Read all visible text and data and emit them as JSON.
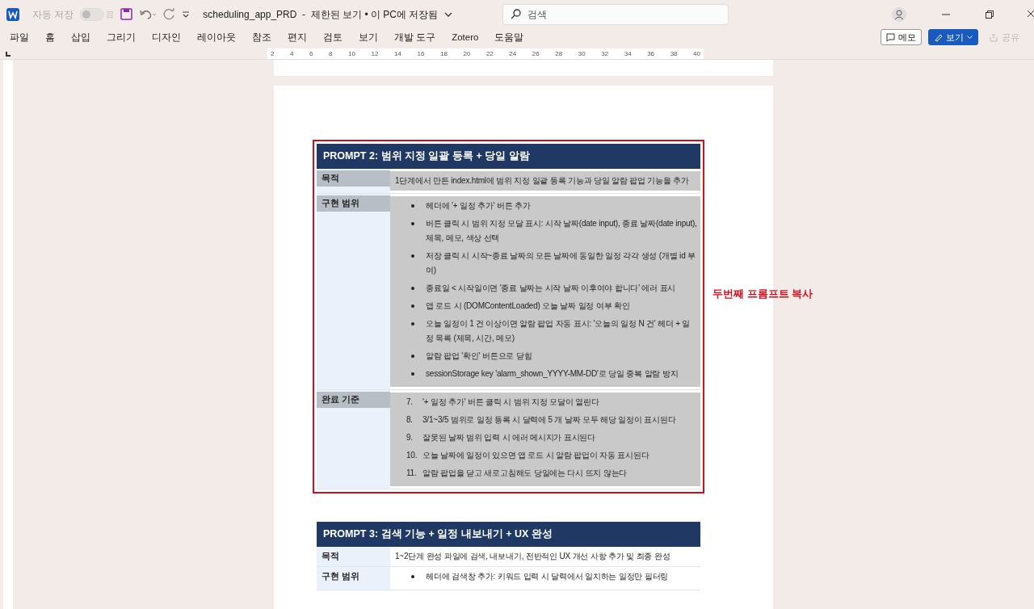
{
  "titlebar": {
    "autosave_label": "자동 저장",
    "autosave_state": "끔",
    "autosave_on": false,
    "document_title": "scheduling_app_PRD  -  제한된 보기 • 이 PC에 저장됨",
    "search": {
      "placeholder": "검색"
    }
  },
  "ribbon_tabs": [
    {
      "label": "파일",
      "selected": false
    },
    {
      "label": "홈",
      "selected": false
    },
    {
      "label": "삽입",
      "selected": false
    },
    {
      "label": "그리기",
      "selected": false
    },
    {
      "label": "디자인",
      "selected": false
    },
    {
      "label": "레이아웃",
      "selected": false
    },
    {
      "label": "참조",
      "selected": false
    },
    {
      "label": "편지",
      "selected": false
    },
    {
      "label": "검토",
      "selected": false
    },
    {
      "label": "보기",
      "selected": false
    },
    {
      "label": "개발 도구",
      "selected": false
    },
    {
      "label": "Zotero",
      "selected": false
    },
    {
      "label": "도움말",
      "selected": false
    }
  ],
  "ribbon_buttons": [
    {
      "label": "메모",
      "kind": "outline",
      "disabled": false
    },
    {
      "label": "보기",
      "kind": "primary",
      "disabled": false
    },
    {
      "label": "공유",
      "kind": "plain",
      "disabled": true
    }
  ],
  "ruler": [
    "2",
    "4",
    "6",
    "8",
    "10",
    "12",
    "14",
    "16",
    "18",
    "20",
    "22",
    "24",
    "26",
    "28",
    "30",
    "32",
    "34",
    "36",
    "38",
    "40"
  ],
  "tables": [
    {
      "title": "PROMPT 2: 범위 지정 일괄 등록 + 당일 알람",
      "selected": true,
      "callout": "두번째 프롬프트 복사",
      "rows": [
        {
          "label": "목적",
          "kind": "text",
          "text": "1단계에서 만든 index.html에 범위 지정 일괄 등록 기능과 당일 알람 팝업 기능을 추가"
        },
        {
          "label": "구현 범위",
          "kind": "bullets",
          "items": [
            "헤더에 '+ 일정 추가' 버튼 추가",
            "버튼 클릭 시 범위 지정 모달 표시: 시작 날짜(date input), 종료 날짜(date input), 제목, 메모, 색상 선택",
            "저장 클릭 시 시작~종료 날짜의 모든 날짜에 동일한 일정 각각 생성 (개별 id 부여)",
            "종료일 < 시작일이면 '종료 날짜는 시작 날짜 이후여야 합니다' 에러 표시",
            "앱 로드 시 (DOMContentLoaded) 오늘 날짜 일정 여부 확인",
            "오늘 일정이 1 건 이상이면 알람 팝업 자동 표시: '오늘의 일정 N 건' 헤더 + 일정 목록 (제목, 시간, 메모)",
            "알람 팝업 '확인' 버튼으로 닫힘",
            "sessionStorage key 'alarm_shown_YYYY-MM-DD'로 당일 중복 알람 방지"
          ]
        },
        {
          "label": "완료 기준",
          "kind": "numbered",
          "items": [
            {
              "number": "7.",
              "text": "'+ 일정 추가' 버튼 클릭 시 범위 지정 모달이 열린다"
            },
            {
              "number": "8.",
              "text": "3/1~3/5 범위로 일정 등록 시 달력에 5 개 날짜 모두 해당 일정이 표시된다"
            },
            {
              "number": "9.",
              "text": "잘못된 날짜 범위 입력 시 에러 메시지가 표시된다"
            },
            {
              "number": "10.",
              "text": "오늘 날짜에 일정이 있으면 앱 로드 시 알람 팝업이 자동 표시된다"
            },
            {
              "number": "11.",
              "text": "알람 팝업을 닫고 새로고침해도 당일에는 다시 뜨지 않는다"
            }
          ]
        }
      ]
    },
    {
      "title": "PROMPT 3: 검색 기능 + 일정 내보내기 + UX 완성",
      "selected": false,
      "rows": [
        {
          "label": "목적",
          "kind": "text",
          "text": "1~2단계 완성 파일에 검색, 내보내기, 전반적인 UX 개선 사항 추가 및 최종 완성"
        },
        {
          "label": "구현 범위",
          "kind": "bullets",
          "items": [
            "헤더에 검색창 추가: 키워드 입력 시 달력에서 일치하는 일정만 필터링"
          ]
        }
      ]
    }
  ]
}
